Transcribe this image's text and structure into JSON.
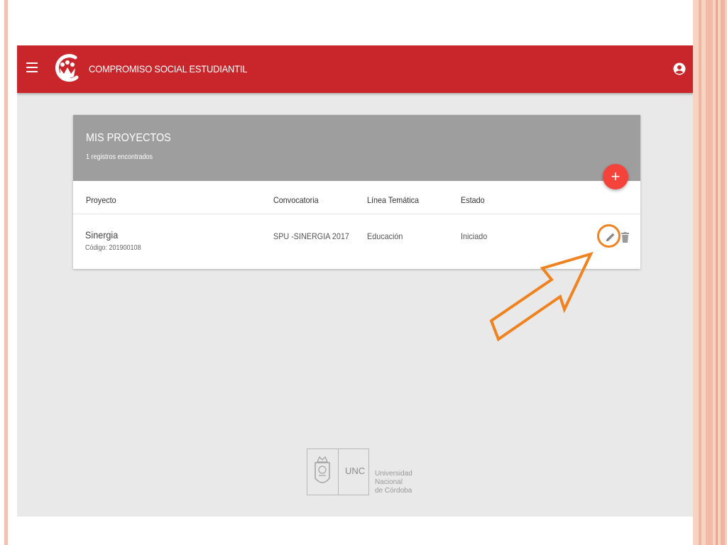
{
  "app": {
    "title": "COMPROMISO SOCIAL ESTUDIANTIL",
    "brand_color": "#c9262c"
  },
  "icons": {
    "menu": "hamburger-menu-icon",
    "logo": "compromiso-social-logo",
    "account": "account-circle-icon",
    "add": "plus-icon",
    "edit": "pencil-icon",
    "delete": "trash-icon"
  },
  "card": {
    "title": "MIS PROYECTOS",
    "subtitle": "1 registros encontrados",
    "header_color": "#9e9e9e",
    "add_button_label": "+",
    "add_button_color": "#f4433b"
  },
  "table": {
    "columns": [
      "Proyecto",
      "Convocatoria",
      "Línea Temática",
      "Estado"
    ],
    "rows": [
      {
        "proyecto": "Sinergia",
        "codigo": "Código: 201900108",
        "convocatoria": "SPU -SINERGIA 2017",
        "linea_tematica": "Educación",
        "estado": "Iniciado"
      }
    ]
  },
  "annotation": {
    "highlight_color": "#f0821f",
    "target": "edit-button"
  },
  "footer": {
    "abbr": "UNC",
    "name_lines": [
      "Universidad",
      "Nacional",
      "de Córdoba"
    ]
  }
}
